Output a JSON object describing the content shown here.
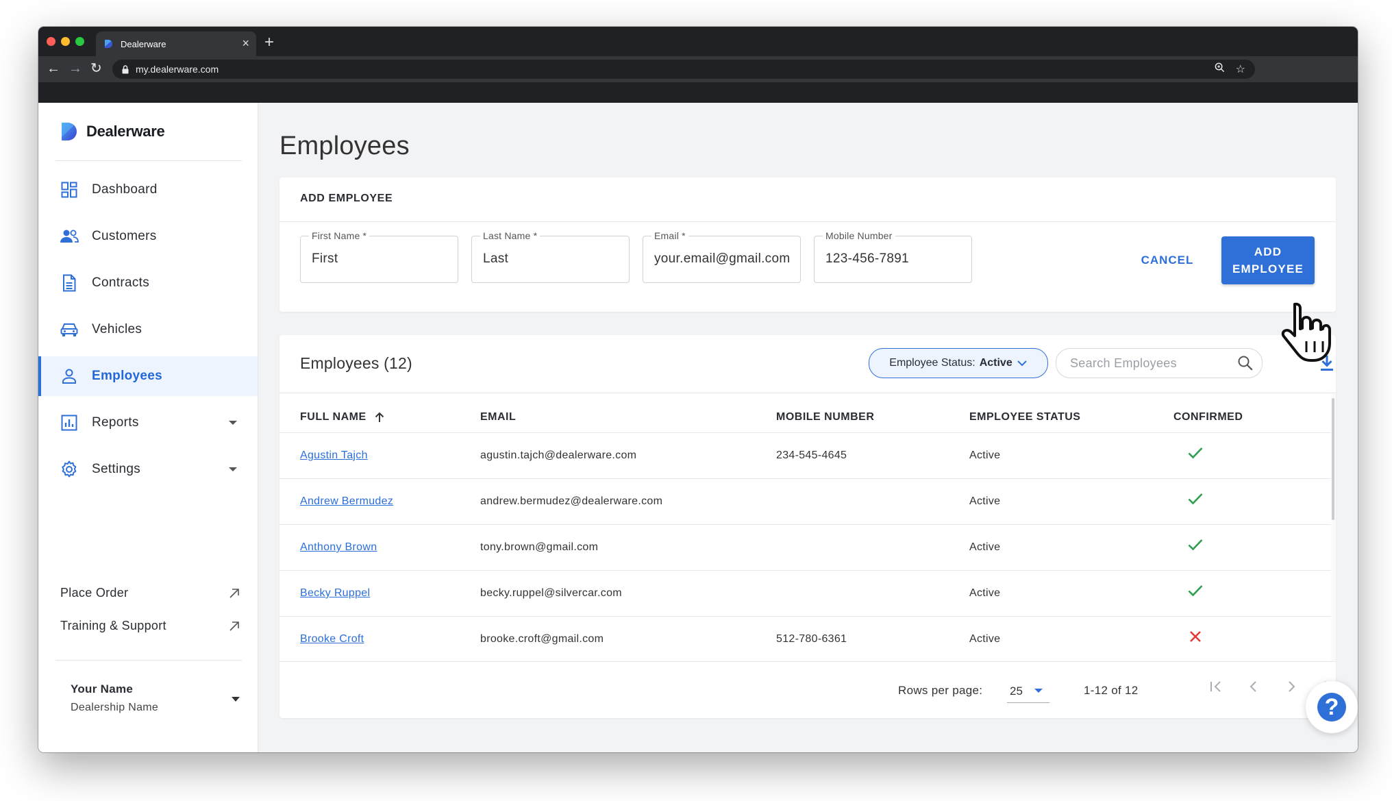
{
  "browser": {
    "tab_title": "Dealerware",
    "tab_close": "×",
    "new_tab": "+",
    "url": "my.dealerware.com"
  },
  "brand": {
    "name": "Dealerware",
    "accent": "#2f6fd8"
  },
  "sidebar": {
    "items": [
      {
        "label": "Dashboard",
        "icon": "dashboard-icon"
      },
      {
        "label": "Customers",
        "icon": "customers-icon"
      },
      {
        "label": "Contracts",
        "icon": "contracts-icon"
      },
      {
        "label": "Vehicles",
        "icon": "vehicle-icon"
      },
      {
        "label": "Employees",
        "icon": "employee-icon",
        "active": true
      },
      {
        "label": "Reports",
        "icon": "reports-icon"
      },
      {
        "label": "Settings",
        "icon": "gear-icon"
      }
    ],
    "links": [
      {
        "label": "Place Order",
        "icon": "external-link-icon"
      },
      {
        "label": "Training & Support",
        "icon": "external-link-icon"
      }
    ],
    "user": {
      "name": "Your Name",
      "dealership": "Dealership Name"
    }
  },
  "page": {
    "title": "Employees"
  },
  "add_employee": {
    "heading": "ADD EMPLOYEE",
    "fields": [
      {
        "label": "First Name *",
        "value": "First"
      },
      {
        "label": "Last Name *",
        "value": "Last"
      },
      {
        "label": "Email *",
        "value": "your.email@gmail.com"
      },
      {
        "label": "Mobile Number",
        "value": "123-456-7891"
      }
    ],
    "cancel_label": "CANCEL",
    "submit_line1": "ADD",
    "submit_line2": "EMPLOYEE"
  },
  "employees": {
    "title": "Employees (12)",
    "status_filter_prefix": "Employee Status:",
    "status_filter_value": "Active",
    "search_placeholder": "Search Employees",
    "columns": [
      "FULL NAME",
      "EMAIL",
      "MOBILE NUMBER",
      "EMPLOYEE STATUS",
      "CONFIRMED"
    ],
    "rows": [
      {
        "name": "Agustin Tajch",
        "email": "agustin.tajch@dealerware.com",
        "mobile": "234-545-4645",
        "status": "Active",
        "confirmed": true
      },
      {
        "name": "Andrew Bermudez",
        "email": "andrew.bermudez@dealerware.com",
        "mobile": "",
        "status": "Active",
        "confirmed": true
      },
      {
        "name": "Anthony Brown",
        "email": "tony.brown@gmail.com",
        "mobile": "",
        "status": "Active",
        "confirmed": true
      },
      {
        "name": "Becky Ruppel",
        "email": "becky.ruppel@silvercar.com",
        "mobile": "",
        "status": "Active",
        "confirmed": true
      },
      {
        "name": "Brooke Croft",
        "email": "brooke.croft@gmail.com",
        "mobile": "512-780-6361",
        "status": "Active",
        "confirmed": false
      }
    ],
    "pagination": {
      "rows_per_page_label": "Rows per page:",
      "rows_per_page": "25",
      "range": "1-12 of 12"
    }
  },
  "colors": {
    "confirmed": "#2e9e4f",
    "unconfirmed": "#e53935",
    "link": "#2b6fdb"
  }
}
